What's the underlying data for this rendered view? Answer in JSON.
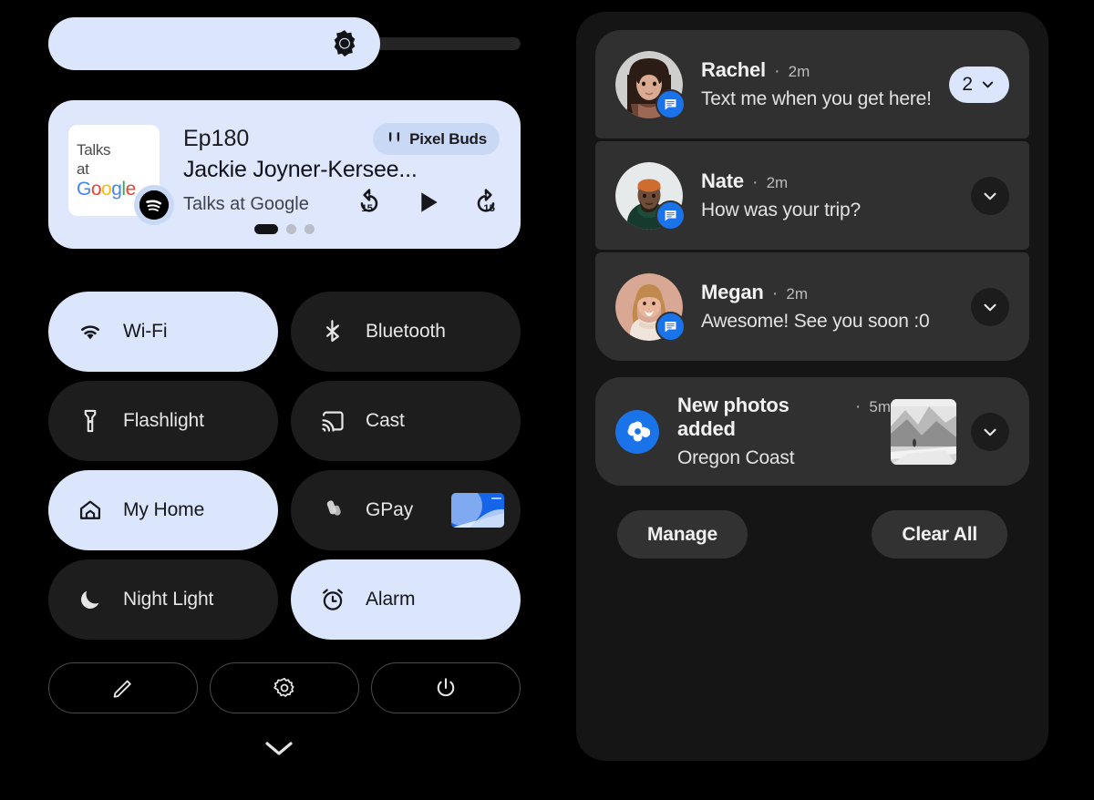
{
  "brightness": {
    "icon": "brightness-icon",
    "level_percent": 70
  },
  "media": {
    "album_art_lines": [
      "Talks",
      "at"
    ],
    "album_art_brand": "Google",
    "app_icon": "spotify-icon",
    "episode": "Ep180",
    "title": "Jackie Joyner-Kersee...",
    "subtitle": "Talks at Google",
    "output_device": "Pixel Buds",
    "output_icon": "earbuds-icon",
    "controls": {
      "rewind": "replay-15-icon",
      "play": "play-icon",
      "forward": "forward-15-icon"
    },
    "page_dots": 3,
    "active_dot": 0
  },
  "tiles": [
    {
      "label": "Wi-Fi",
      "icon": "wifi-icon",
      "on": true,
      "extra": null
    },
    {
      "label": "Bluetooth",
      "icon": "bluetooth-icon",
      "on": false,
      "extra": null
    },
    {
      "label": "Flashlight",
      "icon": "flashlight-icon",
      "on": false,
      "extra": null
    },
    {
      "label": "Cast",
      "icon": "cast-icon",
      "on": false,
      "extra": null
    },
    {
      "label": "My Home",
      "icon": "home-icon",
      "on": true,
      "extra": null
    },
    {
      "label": "GPay",
      "icon": "gpay-icon",
      "on": false,
      "extra": "payment-card"
    },
    {
      "label": "Night Light",
      "icon": "moon-icon",
      "on": false,
      "extra": null
    },
    {
      "label": "Alarm",
      "icon": "alarm-icon",
      "on": true,
      "extra": null
    }
  ],
  "footer_buttons": [
    {
      "name": "edit-tiles-button",
      "icon": "pencil-icon"
    },
    {
      "name": "settings-button",
      "icon": "gear-icon"
    },
    {
      "name": "power-button",
      "icon": "power-icon"
    }
  ],
  "collapse_handle_icon": "chevron-down-icon",
  "notifications": [
    {
      "name": "Rachel",
      "separator": "·",
      "time": "2m",
      "message": "Text me when you get here!",
      "app_icon": "messages-icon",
      "avatar": "rachel-avatar",
      "badge_count": "2",
      "expand_icon": "chevron-down-icon"
    },
    {
      "name": "Nate",
      "separator": "·",
      "time": "2m",
      "message": "How was your trip?",
      "app_icon": "messages-icon",
      "avatar": "nate-avatar",
      "badge_count": null,
      "expand_icon": "chevron-down-icon"
    },
    {
      "name": "Megan",
      "separator": "·",
      "time": "2m",
      "message": "Awesome! See you soon :0",
      "app_icon": "messages-icon",
      "avatar": "megan-avatar",
      "badge_count": null,
      "expand_icon": "chevron-down-icon"
    }
  ],
  "photos_notification": {
    "title": "New photos added",
    "separator": "·",
    "time": "5m",
    "subtitle": "Oregon Coast",
    "app_icon": "google-photos-icon",
    "thumbnail": "oregon-coast-thumbnail",
    "expand_icon": "chevron-down-icon"
  },
  "shade_actions": {
    "manage_label": "Manage",
    "clear_all_label": "Clear All"
  },
  "colors": {
    "background": "#000000",
    "accent_light": "#dbe5fb",
    "tile_off": "#1d1d1d",
    "shade_bg": "#151515",
    "card_bg": "#303030",
    "messages_blue": "#1a73e8"
  }
}
